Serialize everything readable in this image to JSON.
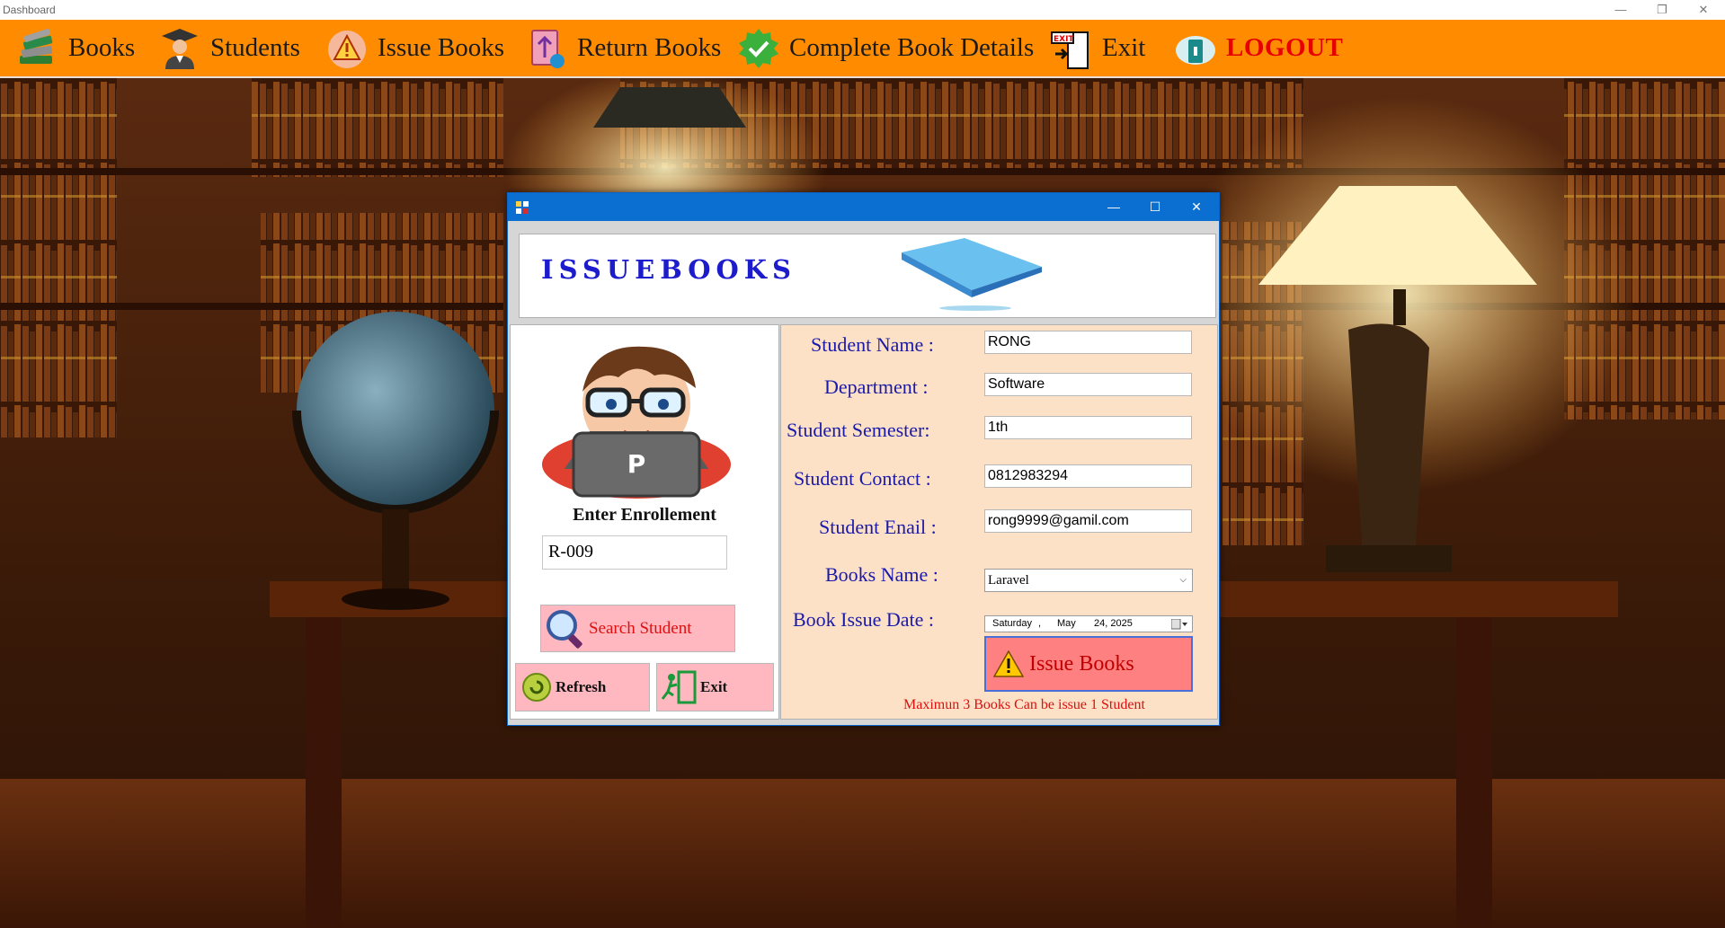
{
  "window": {
    "title": "Dashboard",
    "minimize": "—",
    "maximize": "❐",
    "close": "✕"
  },
  "menu": {
    "books": "Books",
    "students": "Students",
    "issue_books": "Issue Books",
    "return_books": "Return Books",
    "complete_book_details": "Complete Book Details",
    "exit": "Exit",
    "logout": "LOGOUT"
  },
  "dialog": {
    "controls": {
      "minimize": "—",
      "maximize": "☐",
      "close": "✕"
    },
    "banner_title": "ISSUEBOOKS",
    "avatar_letter": "P",
    "enrollment": {
      "label": "Enter Enrollement",
      "value": "R-009"
    },
    "buttons": {
      "search": "Search Student",
      "refresh": "Refresh",
      "exit": "Exit",
      "issue": "Issue Books"
    },
    "fields": {
      "name": {
        "label": "Student Name :",
        "value": "RONG"
      },
      "department": {
        "label": "Department :",
        "value": "Software"
      },
      "semester": {
        "label": "Student Semester:",
        "value": "1th"
      },
      "contact": {
        "label": "Student Contact :",
        "value": "0812983294"
      },
      "email": {
        "label": "Student Enail :",
        "value": "rong9999@gamil.com"
      },
      "book": {
        "label": "Books Name :",
        "value": "Laravel"
      },
      "issue_date": {
        "label": "Book Issue Date :",
        "day": "Saturday",
        "sep": ",",
        "month": "May",
        "date": "24, 2025"
      }
    },
    "note": "Maximun 3 Books Can be issue 1 Student"
  },
  "colors": {
    "menubar": "#ff8c00",
    "dialog_title": "#0a6fd0",
    "banner_text": "#1c1ccc",
    "label_text": "#1a1aaa",
    "form_bg": "#fde1c6",
    "button_pink": "#ffb8c0",
    "note_red": "#dd1010"
  }
}
